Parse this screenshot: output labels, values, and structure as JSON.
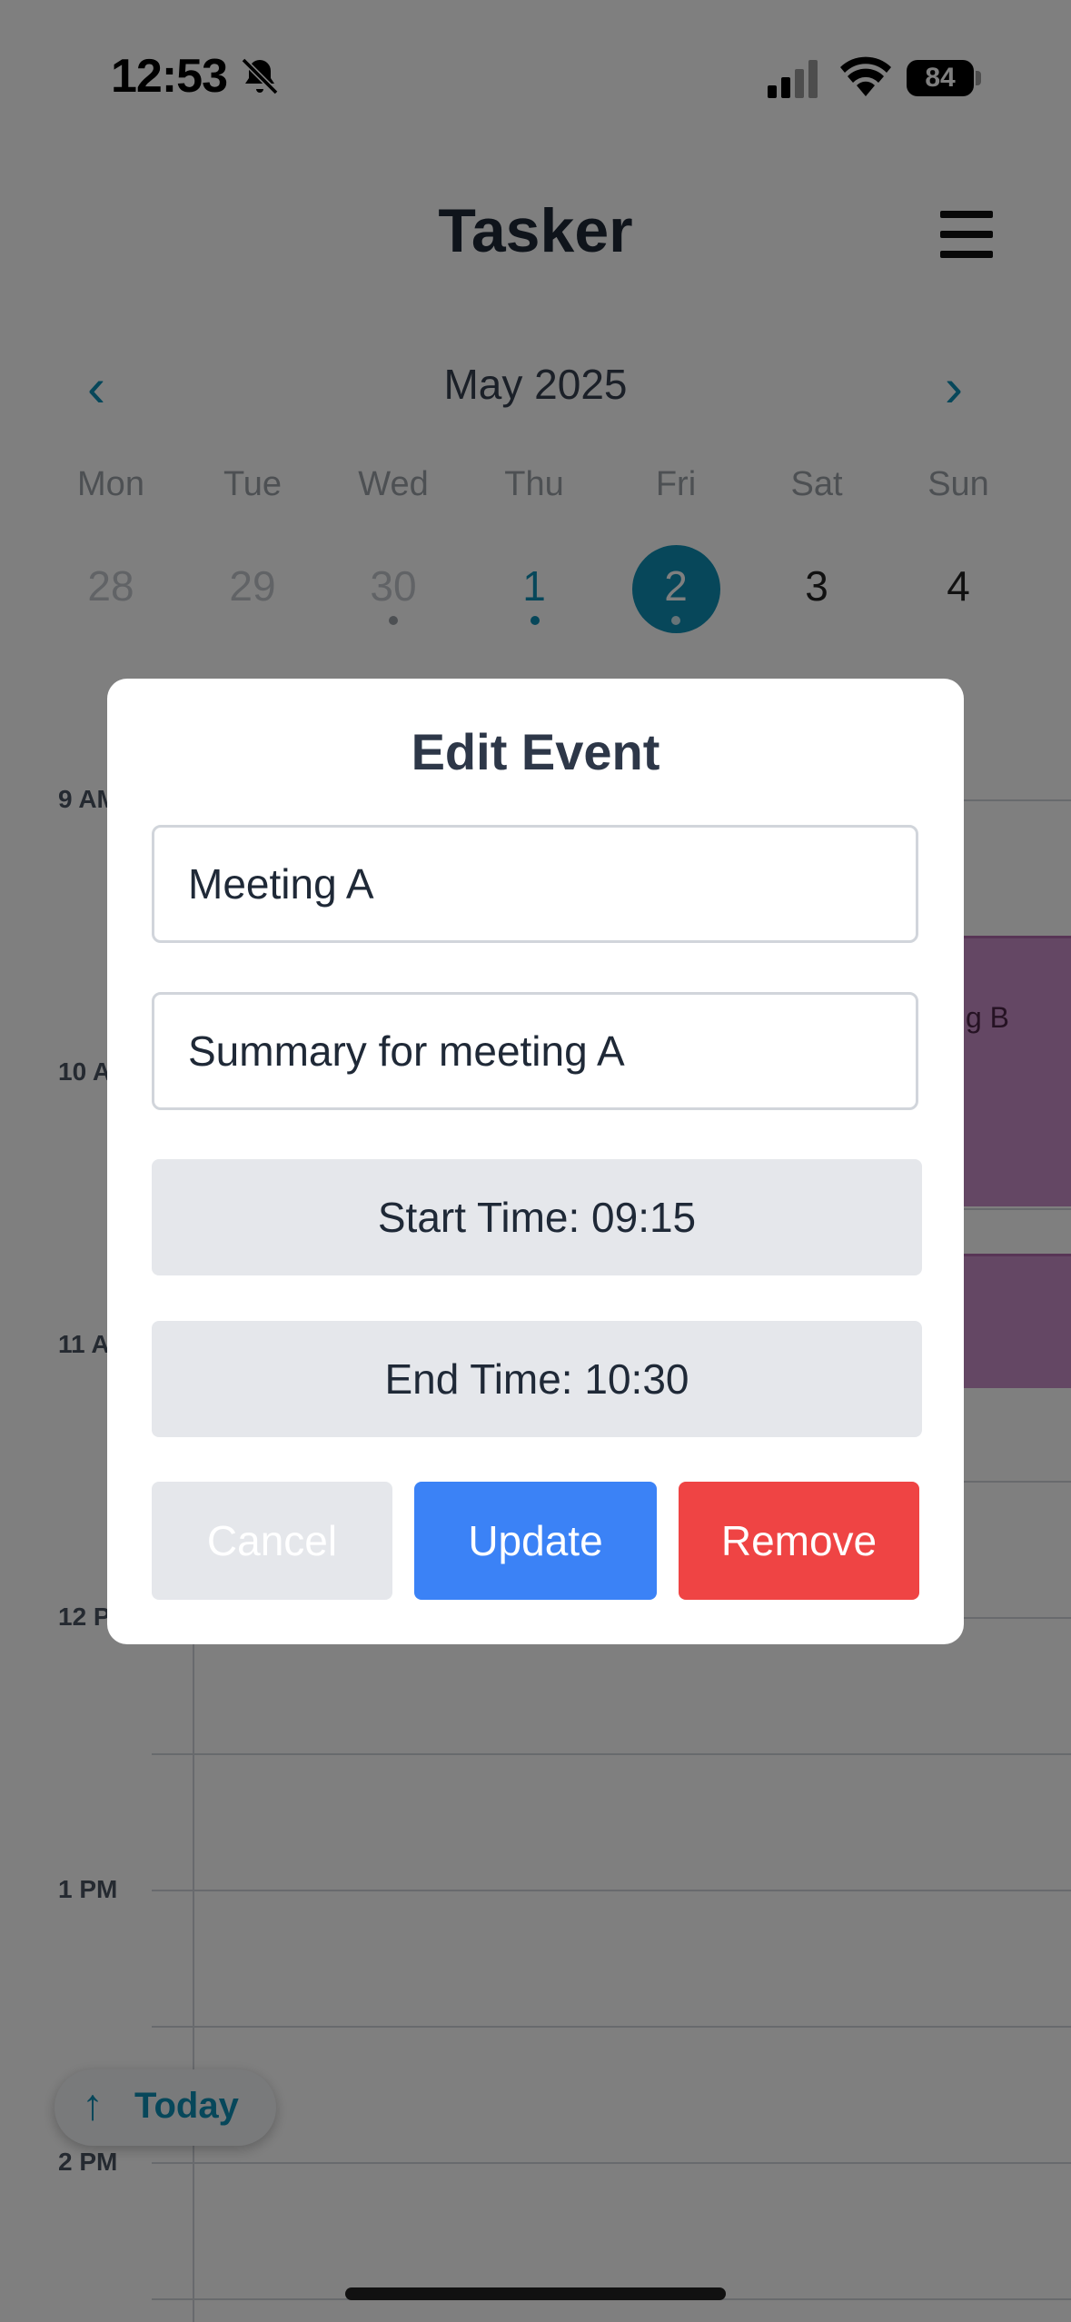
{
  "status_bar": {
    "time": "12:53",
    "battery": "84"
  },
  "header": {
    "title": "Tasker"
  },
  "calendar": {
    "month_label": "May 2025",
    "weekdays": [
      "Mon",
      "Tue",
      "Wed",
      "Thu",
      "Fri",
      "Sat",
      "Sun"
    ],
    "dates": [
      "28",
      "29",
      "30",
      "1",
      "2",
      "3",
      "4"
    ]
  },
  "timeline": {
    "hours": [
      "9 AM",
      "10 AM",
      "11 AM",
      "12 PM",
      "1 PM",
      "2 PM"
    ],
    "event_b_label": "Meeting B"
  },
  "today_button": {
    "label": "Today"
  },
  "modal": {
    "title": "Edit Event",
    "name_value": "Meeting A",
    "summary_value": "Summary for meeting A",
    "start_time": "Start Time: 09:15",
    "end_time": "End Time: 10:30",
    "cancel": "Cancel",
    "update": "Update",
    "remove": "Remove"
  },
  "colors": {
    "accent": "#0e8fb5",
    "update": "#3b82f6",
    "remove": "#ef4444",
    "event": "#c98fc8"
  }
}
